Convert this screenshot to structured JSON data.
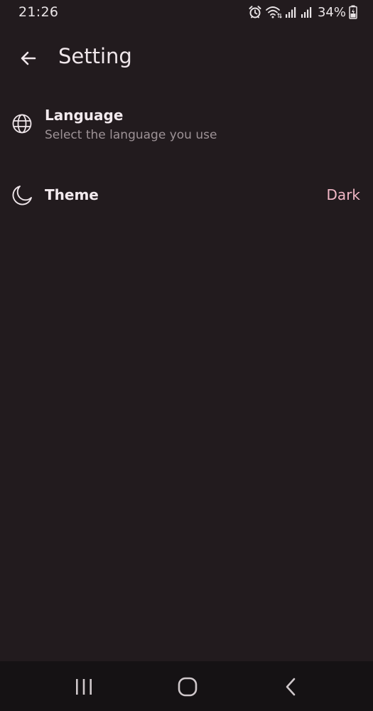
{
  "status_bar": {
    "time": "21:26",
    "battery": "34%",
    "icons": [
      "alarm-icon",
      "wifi-icon",
      "signal-icon",
      "signal-icon",
      "battery-charging-icon"
    ]
  },
  "app_bar": {
    "title": "Setting",
    "back_icon": "arrow-left-icon"
  },
  "settings": {
    "language": {
      "icon": "globe-icon",
      "title": "Language",
      "subtitle": "Select the language you use"
    },
    "theme": {
      "icon": "moon-icon",
      "title": "Theme",
      "value": "Dark"
    }
  },
  "nav_bar": {
    "icons": [
      "recent-apps-icon",
      "home-icon",
      "back-icon"
    ]
  },
  "colors": {
    "background": "#221b1e",
    "text_primary": "#f2eaee",
    "text_secondary": "#9d9296",
    "accent": "#f2b8c6",
    "nav_background": "#151214"
  }
}
